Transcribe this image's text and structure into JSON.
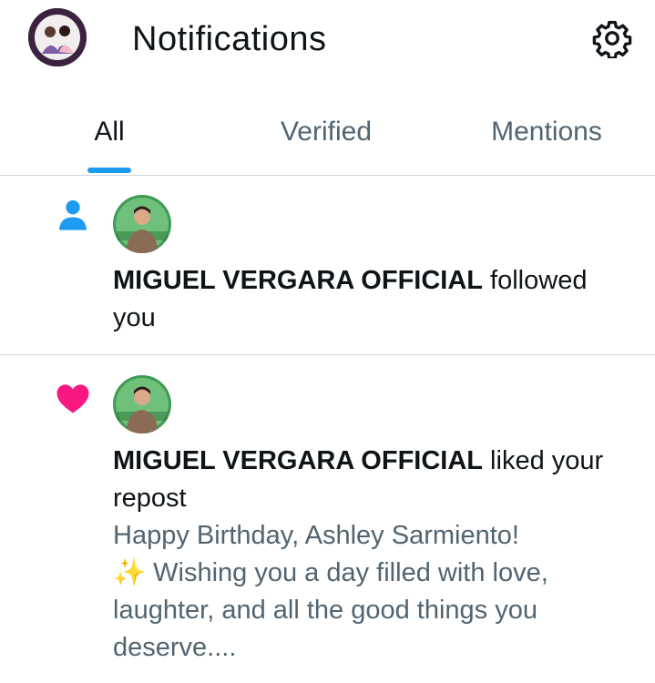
{
  "header": {
    "title": "Notifications",
    "avatar_icon": "profile-avatar",
    "settings_icon": "gear-icon"
  },
  "tabs": [
    {
      "label": "All",
      "active": true
    },
    {
      "label": "Verified",
      "active": false
    },
    {
      "label": "Mentions",
      "active": false
    }
  ],
  "notifications": [
    {
      "type": "follow",
      "icon": "person-icon",
      "icon_color": "#1d9bf0",
      "sender": "MIGUEL VERGARA OFFICIAL",
      "action": " followed you"
    },
    {
      "type": "like",
      "icon": "heart-icon",
      "icon_color": "#f91880",
      "sender": "MIGUEL VERGARA OFFICIAL",
      "action": " liked your repost",
      "quoted_lines": [
        "Happy Birthday, Ashley Sarmiento!",
        "✨ Wishing you a day filled with love, laughter, and all the good things you deserve...."
      ]
    }
  ],
  "colors": {
    "accent": "#1d9bf0",
    "text_primary": "#0f1419",
    "text_secondary": "#536471",
    "divider": "#cfd9de"
  }
}
